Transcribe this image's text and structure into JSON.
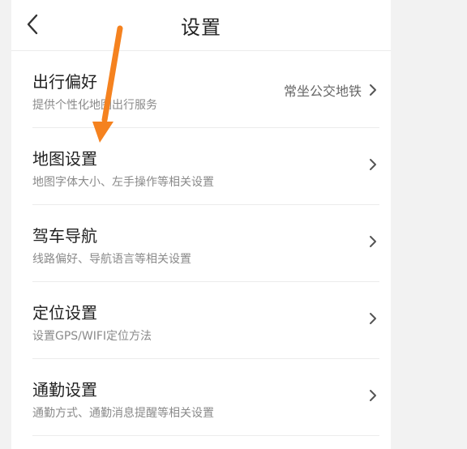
{
  "header": {
    "title": "设置"
  },
  "settings": {
    "items": [
      {
        "title": "出行偏好",
        "subtitle": "提供个性化地图出行服务",
        "value": "常坐公交地铁"
      },
      {
        "title": "地图设置",
        "subtitle": "地图字体大小、左手操作等相关设置",
        "value": ""
      },
      {
        "title": "驾车导航",
        "subtitle": "线路偏好、导航语言等相关设置",
        "value": ""
      },
      {
        "title": "定位设置",
        "subtitle": "设置GPS/WIFI定位方法",
        "value": ""
      },
      {
        "title": "通勤设置",
        "subtitle": "通勤方式、通勤消息提醒等相关设置",
        "value": ""
      }
    ]
  },
  "icons": {
    "back": "chevron-left-icon",
    "row_chevron": "chevron-right-icon"
  },
  "colors": {
    "annotation_arrow": "#f5821f",
    "background": "#f2f2f2",
    "panel": "#ffffff"
  }
}
